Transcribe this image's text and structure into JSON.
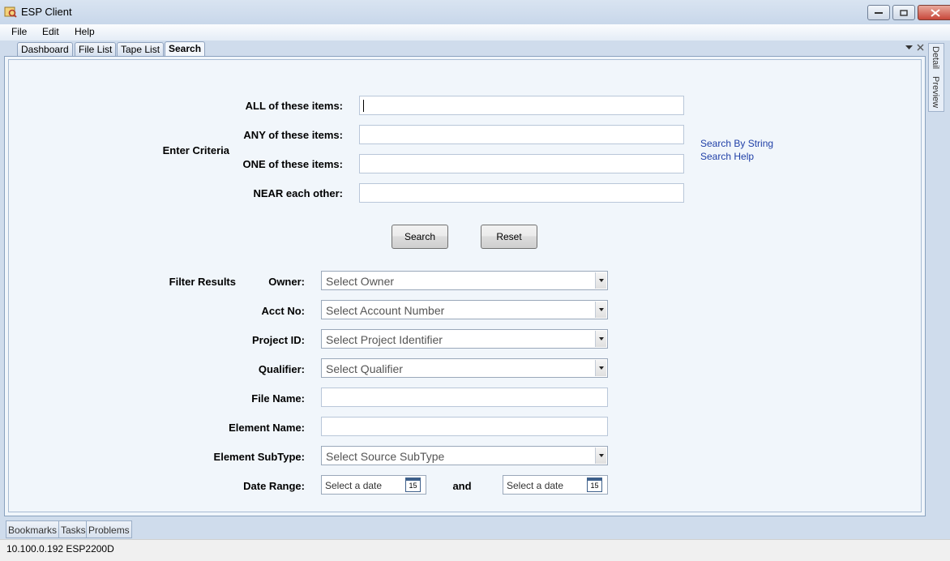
{
  "window": {
    "title": "ESP Client"
  },
  "menu": [
    "File",
    "Edit",
    "Help"
  ],
  "tabs": [
    "Dashboard",
    "File List",
    "Tape List",
    "Search"
  ],
  "side_tabs": [
    "Detail",
    "Preview"
  ],
  "criteria": {
    "section_label": "Enter Criteria",
    "all_label": "ALL of these items:",
    "any_label": "ANY of these items:",
    "one_label": "ONE of these items:",
    "near_label": "NEAR each other:",
    "all_value": "",
    "any_value": "",
    "one_value": "",
    "near_value": ""
  },
  "links": {
    "search_by_string": "Search By String",
    "search_help": "Search Help"
  },
  "buttons": {
    "search": "Search",
    "reset": "Reset"
  },
  "filter": {
    "section_label": "Filter Results",
    "owner_label": "Owner:",
    "owner_value": "Select Owner",
    "acct_label": "Acct No:",
    "acct_value": "Select Account Number",
    "project_label": "Project ID:",
    "project_value": "Select Project Identifier",
    "qualifier_label": "Qualifier:",
    "qualifier_value": "Select Qualifier",
    "filename_label": "File Name:",
    "filename_value": "",
    "element_label": "Element Name:",
    "element_value": "",
    "subtype_label": "Element SubType:",
    "subtype_value": "Select Source SubType",
    "date_label": "Date Range:",
    "date_from": "Select a date",
    "date_and": "and",
    "date_to": "Select a date",
    "cal_day": "15"
  },
  "bottom_tabs": [
    "Bookmarks",
    "Tasks",
    "Problems"
  ],
  "status": "10.100.0.192  ESP2200D"
}
